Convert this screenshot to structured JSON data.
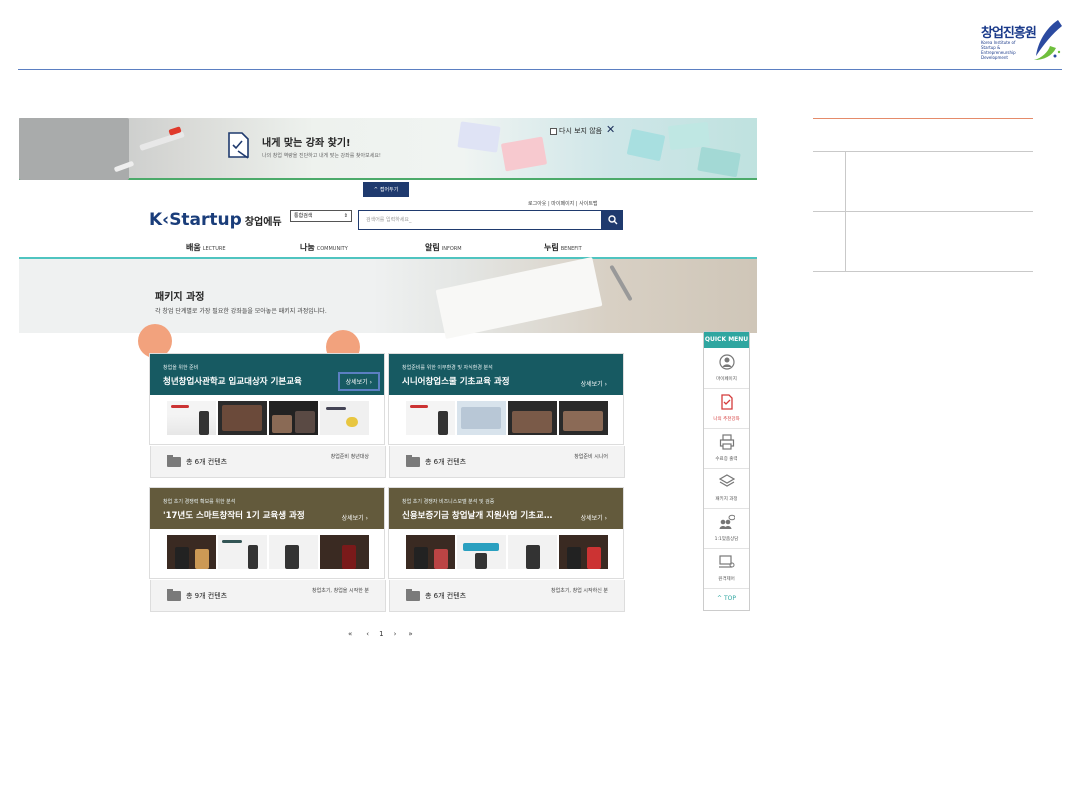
{
  "logo": {
    "title": "창업진흥원",
    "subtitle": "Korea Institute of Startup & Entrepreneurship Development"
  },
  "promo": {
    "title": "내게 맞는 강좌 찾기!",
    "subtitle": "나의 창업 역량을 진단하고 내게 맞는 강좌를 찾아보세요!",
    "dont_show": "다시 보지 않음",
    "close_icon": "close-icon"
  },
  "collapse_tab": "접어두기",
  "util_links": "로그아웃  |  마이페이지  |  사이트맵",
  "brand": {
    "name": "Startup",
    "suffix": "창업에듀"
  },
  "search": {
    "select_value": "통합검색",
    "placeholder": "검색어를 입력하세요_"
  },
  "nav": [
    {
      "label": "배움",
      "sub": "LECTURE"
    },
    {
      "label": "나눔",
      "sub": "COMMUNITY"
    },
    {
      "label": "알림",
      "sub": "INFORM"
    },
    {
      "label": "누림",
      "sub": "BENEFIT"
    }
  ],
  "hero": {
    "title": "패키지 과정",
    "subtitle": "각 창업 단계별로 가장 필요한 강좌들을 모아놓은 패키지 과정입니다."
  },
  "cards": [
    {
      "category": "창업을 위한 준비",
      "title": "청년창업사관학교 입교대상자 기본교육",
      "more": "상세보기 ›",
      "count": "총 6개 컨텐츠",
      "target": "창업준비 청년대상",
      "color": "#175a62",
      "highlight": true
    },
    {
      "category": "창업준비를 위한 이무환경 및 자식환경 분석",
      "title": "시니어창업스쿨 기초교육 과정",
      "more": "상세보기 ›",
      "count": "총 6개 컨텐츠",
      "target": "창업준비 시니어",
      "color": "#175a62",
      "highlight": false
    },
    {
      "category": "창업 초기 경쟁력 확보를 위한 분석",
      "title": "'17년도 스마트창작터 1기 교육생 과정",
      "more": "상세보기 ›",
      "count": "총 9개 컨텐츠",
      "target": "창업초기, 창업을 시작한 분",
      "color": "#635a3c",
      "highlight": false
    },
    {
      "category": "창업 초기 경쟁자 비즈니스모델 분석 및 검증",
      "title": "신용보증기금 창업날개 지원사업 기초교…",
      "more": "상세보기 ›",
      "count": "총 6개 컨텐츠",
      "target": "창업초기, 창업 시작하신 분",
      "color": "#635a3c",
      "highlight": false
    }
  ],
  "pager": [
    "«",
    "‹",
    "1",
    "›",
    "»"
  ],
  "quick_menu": {
    "title": "QUICK MENU",
    "items": [
      {
        "label": "마이페이지",
        "icon": "user-icon"
      },
      {
        "label": "나의 추천강좌",
        "icon": "recommend-icon"
      },
      {
        "label": "수료증 출력",
        "icon": "printer-icon"
      },
      {
        "label": "패키지 과정",
        "icon": "package-icon"
      },
      {
        "label": "1:1맞춤상담",
        "icon": "chat-icon"
      },
      {
        "label": "원격제어",
        "icon": "remote-icon"
      }
    ],
    "top": "TOP"
  },
  "colors": {
    "navy": "#1f3a6e",
    "teal": "#175a62",
    "olive": "#635a3c",
    "marker": "#f2a27d",
    "quickmenu": "#2fa6a0"
  }
}
